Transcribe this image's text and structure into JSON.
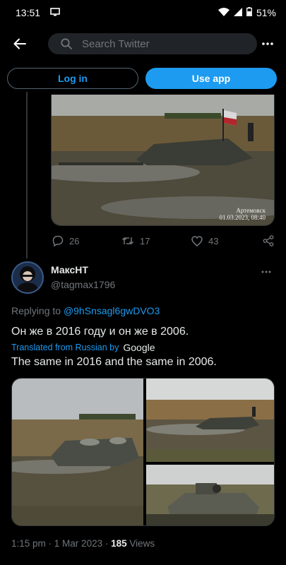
{
  "status": {
    "time": "13:51",
    "battery": "51%"
  },
  "search": {
    "placeholder": "Search Twitter"
  },
  "cta": {
    "login_label": "Log in",
    "app_label": "Use app"
  },
  "prev_tweet": {
    "photo_caption_place": "Артемовск",
    "photo_caption_date": "01.03.2023, 08:40",
    "replies": "26",
    "retweets": "17",
    "likes": "43"
  },
  "tweet": {
    "author_name": "МаксНТ",
    "author_handle": "@tagmax1796",
    "replying_prefix": "Replying to",
    "replying_to": "@9hSnsagl6gwDVO3",
    "text": "Он же в 2016 году и он же в 2006.",
    "translated_label": "Translated from Russian by",
    "translator": "Google",
    "translation": "The same in 2016 and the same in 2006.",
    "time": "1:15 pm",
    "date": "1 Mar 2023",
    "views_count": "185",
    "views_label": "Views"
  }
}
